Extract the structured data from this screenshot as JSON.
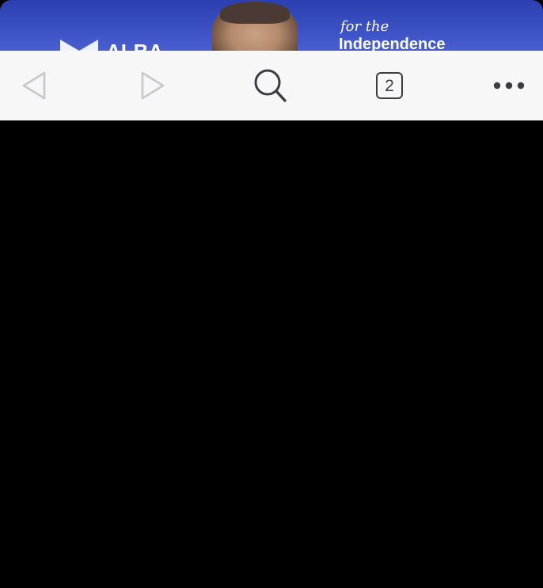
{
  "banner": {
    "logo_text": "ALBA",
    "tagline_small": "for the",
    "tagline_big": "Independence",
    "background_color": "#3a4fc2"
  },
  "toolbar": {
    "back_icon": "back-arrow-icon",
    "back_enabled": false,
    "forward_icon": "forward-arrow-icon",
    "forward_enabled": false,
    "search_icon": "search-icon",
    "tab_count": "2",
    "more_icon": "more-dots-icon",
    "background_color": "#f7f7f7",
    "icon_color": "#3c3c43",
    "disabled_icon_color": "#c7c7cc"
  },
  "viewport": {
    "background_color": "#000000"
  }
}
